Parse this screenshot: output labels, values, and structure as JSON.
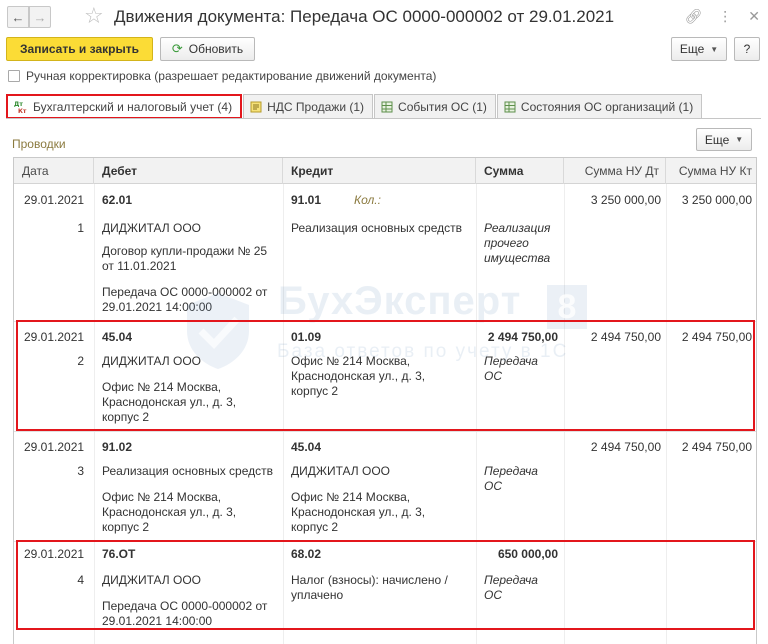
{
  "window": {
    "title": "Движения документа: Передача ОС 0000-000002 от 29.01.2021"
  },
  "toolbar": {
    "save_close": "Записать и закрыть",
    "refresh": "Обновить",
    "more": "Еще",
    "help": "?"
  },
  "manual_correction": {
    "label": "Ручная корректировка (разрешает редактирование движений документа)",
    "checked": false
  },
  "tabs": [
    {
      "label": "Бухгалтерский и налоговый учет (4)",
      "icon": "dt-kt-icon",
      "active": true
    },
    {
      "label": "НДС Продажи (1)",
      "icon": "register-icon",
      "active": false
    },
    {
      "label": "События ОС (1)",
      "icon": "table-icon",
      "active": false
    },
    {
      "label": "Состояния ОС организаций (1)",
      "icon": "table-icon",
      "active": false
    }
  ],
  "section": {
    "title": "Проводки",
    "more": "Еще"
  },
  "columns": [
    "Дата",
    "Дебет",
    "Кредит",
    "Сумма",
    "Сумма НУ Дт",
    "Сумма НУ Кт"
  ],
  "rows": [
    {
      "date": "29.01.2021",
      "num": "1",
      "debit_account": "62.01",
      "debit_sub1": "ДИДЖИТАЛ ООО",
      "debit_sub2": "Договор купли-продажи № 25 от 11.01.2021",
      "debit_sub3": "Передача ОС 0000-000002 от 29.01.2021 14:00:00",
      "credit_account": "91.01",
      "credit_qty": "Кол.:",
      "credit_sub1": "Реализация основных средств",
      "credit_sub2": "",
      "amount": "",
      "content": "Реализация прочего имущества",
      "nu_dt": "3 250 000,00",
      "nu_kt": "3 250 000,00",
      "highlighted": false
    },
    {
      "date": "29.01.2021",
      "num": "2",
      "debit_account": "45.04",
      "debit_sub1": "ДИДЖИТАЛ ООО",
      "debit_sub2": "Офис № 214 Москва, Краснодонская ул., д. 3, корпус 2",
      "debit_sub3": "",
      "credit_account": "01.09",
      "credit_qty": "",
      "credit_sub1": "Офис № 214 Москва, Краснодонская ул., д. 3, корпус 2",
      "credit_sub2": "",
      "amount": "2 494 750,00",
      "content": "Передача ОС",
      "nu_dt": "2 494 750,00",
      "nu_kt": "2 494 750,00",
      "highlighted": true
    },
    {
      "date": "29.01.2021",
      "num": "3",
      "debit_account": "91.02",
      "debit_sub1": "Реализация основных средств",
      "debit_sub2": "Офис № 214 Москва, Краснодонская ул., д. 3, корпус 2",
      "debit_sub3": "",
      "credit_account": "45.04",
      "credit_qty": "",
      "credit_sub1": "ДИДЖИТАЛ ООО",
      "credit_sub2": "Офис № 214 Москва, Краснодонская ул., д. 3, корпус 2",
      "amount": "",
      "content": "Передача ОС",
      "nu_dt": "2 494 750,00",
      "nu_kt": "2 494 750,00",
      "highlighted": false
    },
    {
      "date": "29.01.2021",
      "num": "4",
      "debit_account": "76.ОТ",
      "debit_sub1": "ДИДЖИТАЛ ООО",
      "debit_sub2": "Передача ОС 0000-000002 от 29.01.2021 14:00:00",
      "debit_sub3": "",
      "credit_account": "68.02",
      "credit_qty": "",
      "credit_sub1": "Налог (взносы): начислено / уплачено",
      "credit_sub2": "",
      "amount": "650 000,00",
      "content": "Передача ОС",
      "nu_dt": "",
      "nu_kt": "",
      "highlighted": true
    }
  ],
  "watermark": {
    "name": "БухЭксперт",
    "badge": "8",
    "subtitle": "База ответов по учету в 1С"
  }
}
